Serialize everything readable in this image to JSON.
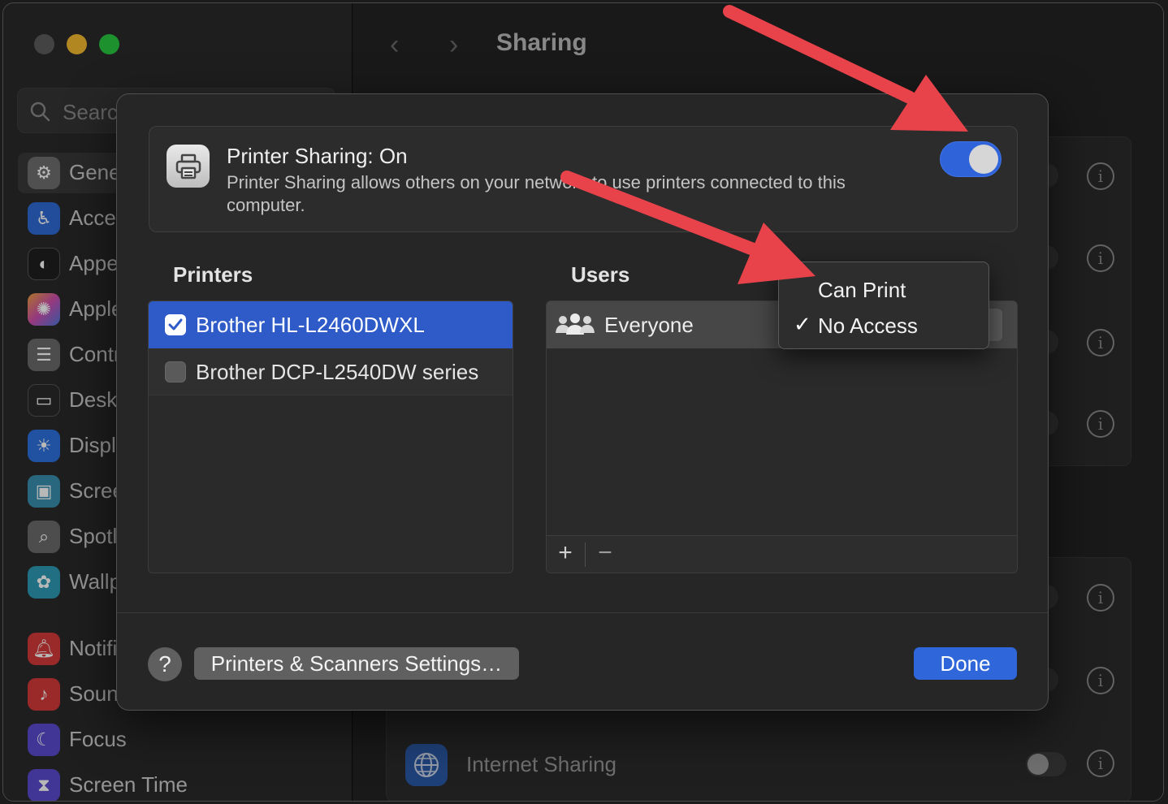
{
  "window": {
    "title": "Sharing"
  },
  "sidebar": {
    "search_placeholder": "Search",
    "items": [
      {
        "label": "General",
        "icon": "gear-icon",
        "color": "#7a7a7a"
      },
      {
        "label": "Accessibility",
        "icon": "accessibility-icon",
        "color": "#2f6bd6"
      },
      {
        "label": "Appearance",
        "icon": "appearance-icon",
        "color": "#3b3b3b"
      },
      {
        "label": "Apple Intelligence & Siri",
        "icon": "siri-icon",
        "color": "#c24fa8"
      },
      {
        "label": "Control Centre",
        "icon": "control-centre-icon",
        "color": "#6b6b6b"
      },
      {
        "label": "Desktop & Dock",
        "icon": "dock-icon",
        "color": "#3a3a3a"
      },
      {
        "label": "Displays",
        "icon": "display-icon",
        "color": "#2f72e0"
      },
      {
        "label": "Screen Saver",
        "icon": "screensaver-icon",
        "color": "#3a8fb0"
      },
      {
        "label": "Spotlight",
        "icon": "spotlight-icon",
        "color": "#6b6b6b"
      },
      {
        "label": "Wallpaper",
        "icon": "wallpaper-icon",
        "color": "#2f9ab5"
      },
      {
        "label": "Notifications",
        "icon": "notifications-icon",
        "color": "#d63a3a"
      },
      {
        "label": "Sound",
        "icon": "sound-icon",
        "color": "#d63a3a"
      },
      {
        "label": "Focus",
        "icon": "focus-icon",
        "color": "#5b4bd0"
      },
      {
        "label": "Screen Time",
        "icon": "screen-time-icon",
        "color": "#5b4bd0"
      }
    ]
  },
  "background": {
    "internet_sharing_label": "Internet Sharing"
  },
  "sheet": {
    "printer_sharing": {
      "title": "Printer Sharing: On",
      "description": "Printer Sharing allows others on your network to use printers connected to this computer.",
      "enabled": true
    },
    "printers_header": "Printers",
    "users_header": "Users",
    "printers": [
      {
        "name": "Brother HL-L2460DWXL",
        "checked": true,
        "selected": true
      },
      {
        "name": "Brother DCP-L2540DW series",
        "checked": false,
        "selected": false
      }
    ],
    "users": [
      {
        "name": "Everyone",
        "access": "No Access"
      }
    ],
    "add_label": "+",
    "remove_label": "−",
    "help_label": "?",
    "settings_button": "Printers & Scanners Settings…",
    "done_button": "Done"
  },
  "menu": {
    "items": [
      {
        "label": "Can Print",
        "checked": false
      },
      {
        "label": "No Access",
        "checked": true
      }
    ],
    "check_glyph": "✓"
  },
  "colors": {
    "accent": "#2f63d9",
    "annotation_arrow": "#e8434b"
  }
}
